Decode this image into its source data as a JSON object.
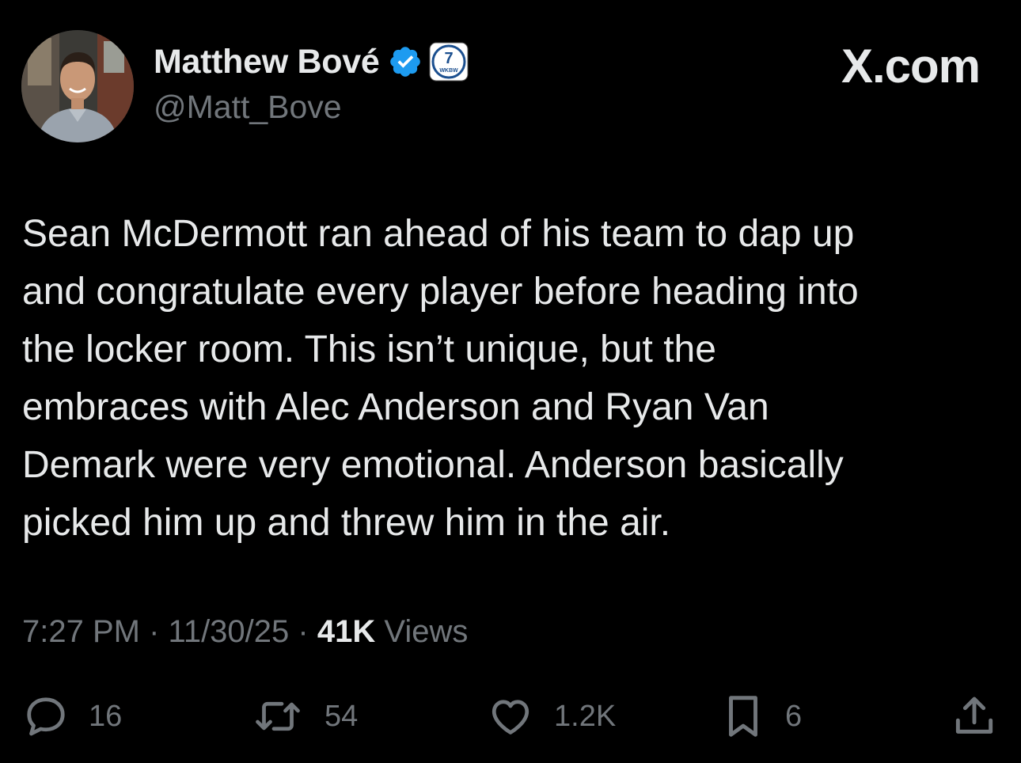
{
  "tweet": {
    "author": {
      "display_name": "Matthew Bové",
      "handle": "@Matt_Bove",
      "affiliate_badge_text": "7",
      "affiliate_badge_subtext": "WKBW"
    },
    "brand": "X.com",
    "text": "Sean McDermott ran ahead of his team to dap up\nand congratulate every player before heading into\nthe locker room. This isn’t unique, but the\nembraces with Alec Anderson and Ryan Van\nDemark were very emotional. Anderson basically\npicked him up and threw him in the air.",
    "time": "7:27 PM",
    "date": "11/30/25",
    "separator": "·",
    "views_count": "41K",
    "views_label": "Views",
    "actions": {
      "replies": "16",
      "reposts": "54",
      "likes": "1.2K",
      "bookmarks": "6"
    }
  },
  "icons": {
    "verified": "verified-check-icon",
    "reply": "speech-bubble-icon",
    "repost": "repost-arrows-icon",
    "like": "heart-icon",
    "bookmark": "bookmark-icon",
    "share": "share-upload-icon"
  },
  "colors": {
    "background": "#000000",
    "primary_text": "#e7e9ea",
    "secondary_text": "#71767b",
    "verified_blue": "#1d9bf0"
  }
}
